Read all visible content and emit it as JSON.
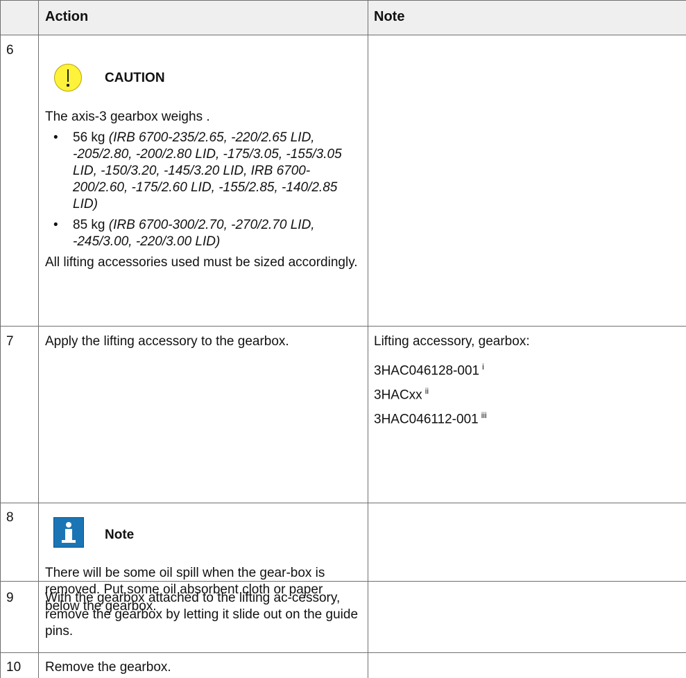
{
  "header": {
    "col_action": "Action",
    "col_note": "Note"
  },
  "rows": {
    "r6": {
      "number": "6",
      "caution_label": "CAUTION",
      "intro": "The axis-3 gearbox weighs .",
      "items": [
        {
          "weight": "56 kg",
          "models": "(IRB 6700-235/2.65, -220/2.65 LID, -205/2.80, -200/2.80 LID, -175/3.05, -155/3.05 LID, -150/3.20, -145/3.20 LID, IRB 6700-200/2.60, -175/2.60 LID, -155/2.85, -140/2.85 LID)"
        },
        {
          "weight": "85 kg",
          "models": "(IRB 6700-300/2.70, -270/2.70 LID, -245/3.00, -220/3.00 LID)"
        }
      ],
      "closing": "All lifting accessories used must be sized accordingly."
    },
    "r7": {
      "number": "7",
      "action": "Apply the lifting accessory to the gearbox.",
      "note_title": "Lifting accessory, gearbox:",
      "refs": [
        {
          "code": "3HAC046128-001",
          "sup": "i"
        },
        {
          "code": "3HACxx",
          "sup": "ii"
        },
        {
          "code": "3HAC046112-001",
          "sup": "iii"
        }
      ]
    },
    "r8": {
      "number": "8",
      "note_label": "Note",
      "text": "There will be some oil spill when the gear-box is removed. Put some oil absorbent cloth or paper below the gearbox."
    },
    "r9": {
      "number": "9",
      "action": "With the gearbox attached to the lifting ac-cessory, remove the gearbox by letting it slide out on the guide pins."
    },
    "r10": {
      "number": "10",
      "action": "Remove the gearbox."
    }
  },
  "icons": {
    "caution": "caution-exclamation-icon",
    "note": "info-note-icon"
  },
  "colors": {
    "caution_yellow": "#fff23a",
    "note_blue": "#1b75b5",
    "header_bg": "#efefef",
    "border": "#6f6f6f"
  }
}
